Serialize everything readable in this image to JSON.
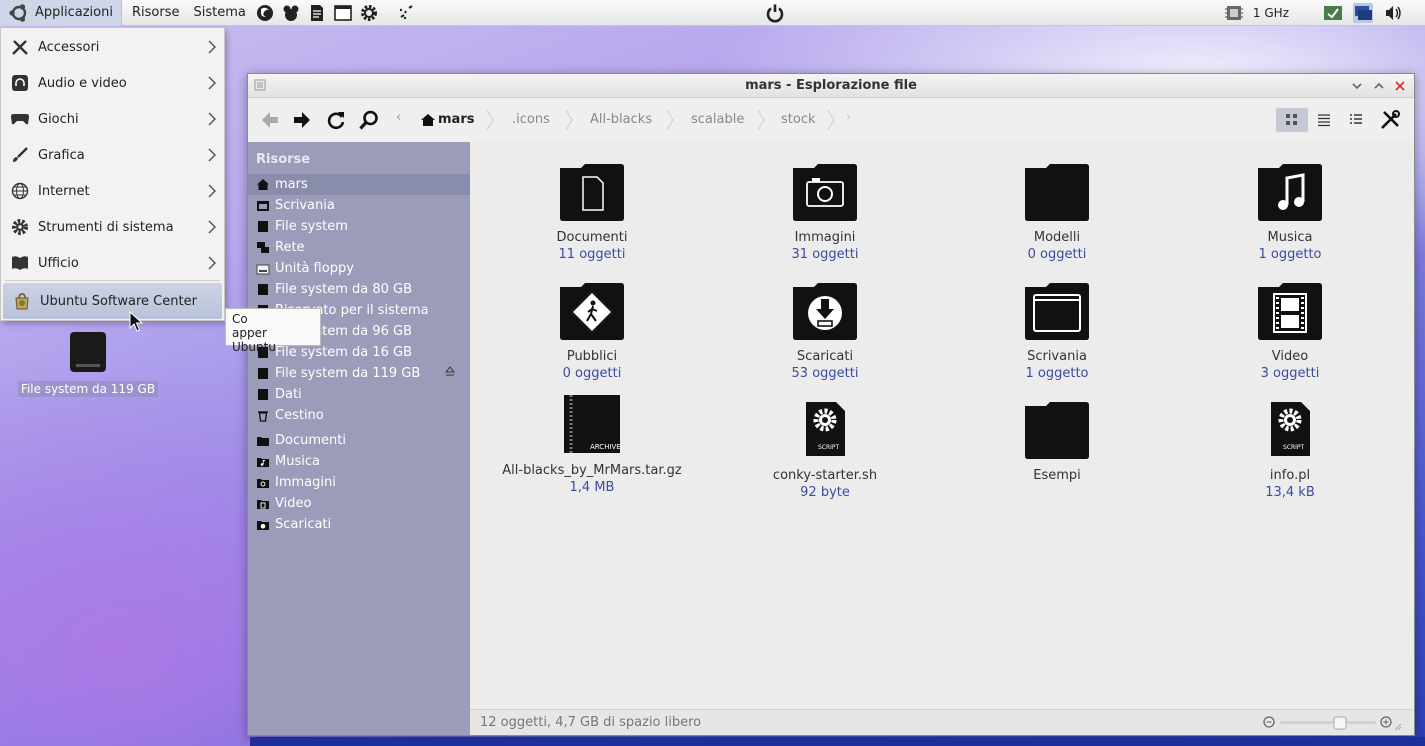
{
  "top_panel": {
    "menus": [
      "Applicazioni",
      "Risorse",
      "Sistema"
    ],
    "launchers": [
      "firefox-icon",
      "gimp-icon",
      "text-editor-icon",
      "terminal-icon",
      "settings-icon",
      "sparkle-launcher-icon"
    ],
    "cpu_frequency": "1 GHz"
  },
  "apps_menu": {
    "items": [
      {
        "label": "Accessori",
        "icon": "tools-icon"
      },
      {
        "label": "Audio e video",
        "icon": "headphones-icon"
      },
      {
        "label": "Giochi",
        "icon": "gamepad-icon"
      },
      {
        "label": "Grafica",
        "icon": "brush-icon"
      },
      {
        "label": "Internet",
        "icon": "globe-icon"
      },
      {
        "label": "Strumenti di sistema",
        "icon": "gear-icon"
      },
      {
        "label": "Ufficio",
        "icon": "book-icon"
      }
    ],
    "special_item": {
      "label": "Ubuntu Software Center",
      "icon": "software-center-icon"
    }
  },
  "tooltip": {
    "line1": "Co",
    "line2": "apper Ubuntu"
  },
  "desktop": {
    "icon_label": "File system da 119 GB"
  },
  "window": {
    "title": "mars - Esplorazione file",
    "breadcrumb": [
      "mars",
      ".icons",
      "All-blacks",
      "scalable",
      "stock"
    ],
    "sidebar": {
      "heading": "Risorse",
      "places": [
        {
          "label": "mars",
          "icon": "home-icon"
        },
        {
          "label": "Scrivania",
          "icon": "desktop-icon"
        },
        {
          "label": "File system",
          "icon": "drive-icon"
        },
        {
          "label": "Rete",
          "icon": "network-icon"
        },
        {
          "label": "Unità floppy",
          "icon": "floppy-icon"
        },
        {
          "label": "File system da 80 GB",
          "icon": "drive-icon"
        },
        {
          "label": "Riservato per il sistema",
          "icon": "drive-icon"
        },
        {
          "label": "File system da 96 GB",
          "icon": "drive-icon"
        },
        {
          "label": "File system da 16 GB",
          "icon": "drive-icon"
        },
        {
          "label": "File system da 119 GB",
          "icon": "drive-icon"
        },
        {
          "label": "Dati",
          "icon": "drive-icon"
        },
        {
          "label": "Cestino",
          "icon": "trash-icon"
        }
      ],
      "bookmarks": [
        {
          "label": "Documenti",
          "icon": "folder-icon"
        },
        {
          "label": "Musica",
          "icon": "music-folder-icon"
        },
        {
          "label": "Immagini",
          "icon": "pictures-folder-icon"
        },
        {
          "label": "Video",
          "icon": "video-folder-icon"
        },
        {
          "label": "Scaricati",
          "icon": "download-folder-icon"
        }
      ]
    },
    "files": [
      {
        "name": "Documenti",
        "meta": "11 oggetti",
        "icon": "documents-folder"
      },
      {
        "name": "Immagini",
        "meta": "31 oggetti",
        "icon": "pictures-folder"
      },
      {
        "name": "Modelli",
        "meta": "0 oggetti",
        "icon": "folder"
      },
      {
        "name": "Musica",
        "meta": "1 oggetto",
        "icon": "music-folder"
      },
      {
        "name": "Pubblici",
        "meta": "0 oggetti",
        "icon": "public-folder"
      },
      {
        "name": "Scaricati",
        "meta": "53 oggetti",
        "icon": "download-folder"
      },
      {
        "name": "Scrivania",
        "meta": "1 oggetto",
        "icon": "desktop-folder"
      },
      {
        "name": "Video",
        "meta": "3 oggetti",
        "icon": "video-folder"
      },
      {
        "name": "All-blacks_by_MrMars.tar.gz",
        "meta": "1,4 MB",
        "icon": "archive-file",
        "badge": "ARCHIVE"
      },
      {
        "name": "conky-starter.sh",
        "meta": "92 byte",
        "icon": "script-file",
        "badge": "SCRIPT"
      },
      {
        "name": "Esempi",
        "meta": "",
        "icon": "folder"
      },
      {
        "name": "info.pl",
        "meta": "13,4 kB",
        "icon": "script-file",
        "badge": "SCRIPT"
      }
    ],
    "status": "12 oggetti, 4,7 GB di spazio libero"
  }
}
